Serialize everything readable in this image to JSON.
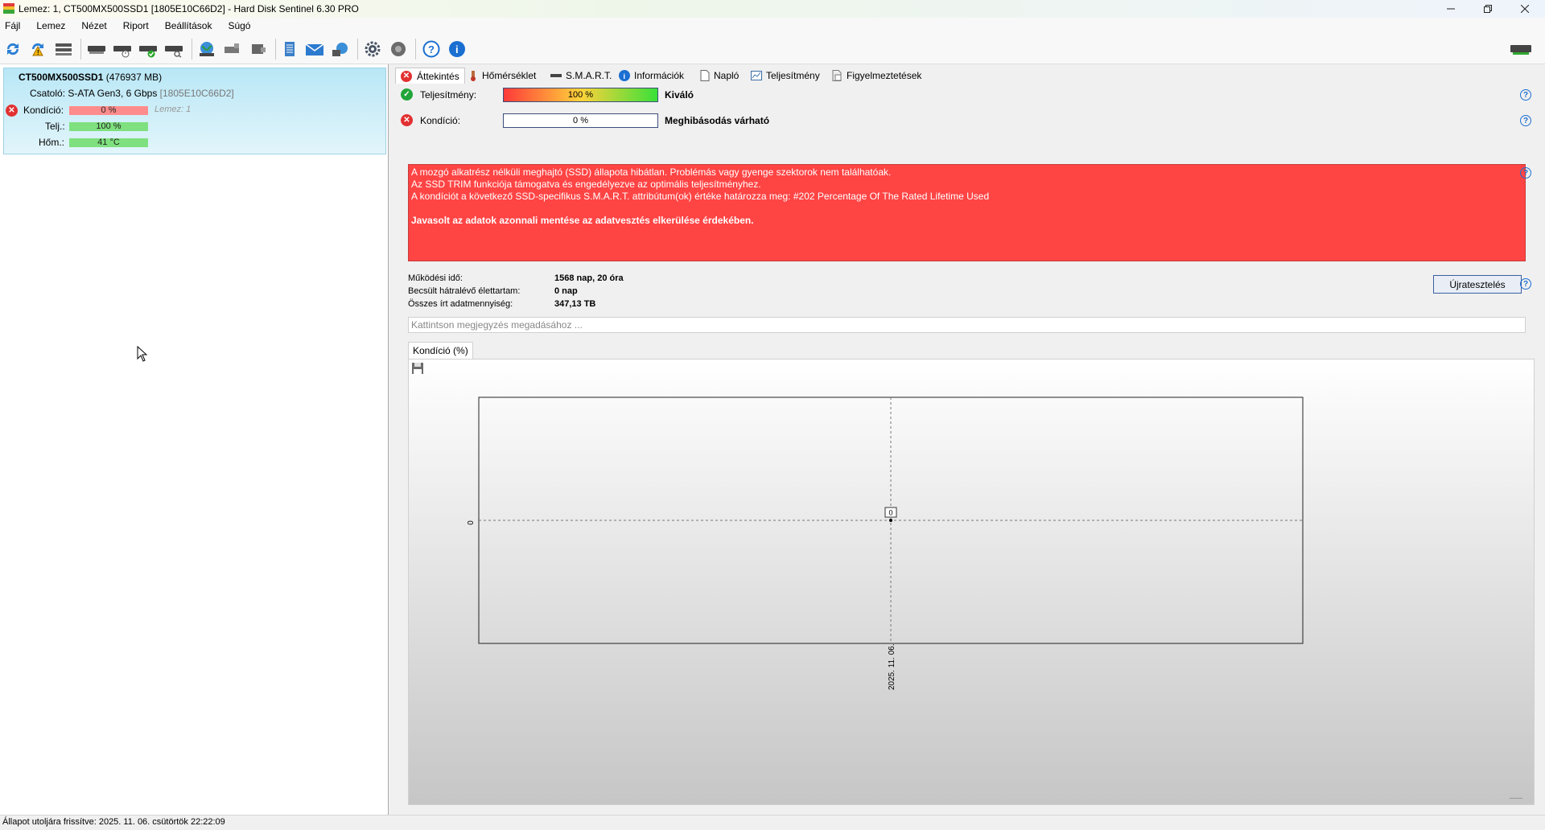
{
  "window": {
    "title": "Lemez: 1, CT500MX500SSD1 [1805E10C66D2]  -  Hard Disk Sentinel 6.30 PRO",
    "minimize_icon": "minimize-icon",
    "maximize_icon": "restore-icon",
    "close_icon": "close-icon"
  },
  "menu": [
    "Fájl",
    "Lemez",
    "Nézet",
    "Riport",
    "Beállítások",
    "Súgó"
  ],
  "toolbar_icons": [
    "refresh-icon",
    "refresh-warning-icon",
    "disk-list-icon",
    "disk-icon",
    "disk-clock-icon",
    "disk-check-icon",
    "disk-search-icon",
    "globe-icon",
    "tools-icon",
    "usb-icon",
    "notes-icon",
    "email-icon",
    "network-icon",
    "settings-icon",
    "sound-icon",
    "help-icon",
    "info-icon"
  ],
  "disk": {
    "name": "CT500MX500SSD1",
    "size": "(476937 MB)",
    "interface_label": "Csatoló:",
    "interface": "S-ATA Gen3, 6 Gbps",
    "serial": "[1805E10C66D2]",
    "health_label": "Kondíció:",
    "health_value": "0 %",
    "health_fraction": 0.0,
    "disk_index": "Lemez: 1",
    "perf_label": "Telj.:",
    "perf_value": "100 %",
    "perf_fraction": 1.0,
    "temp_label": "Hőm.:",
    "temp_value": "41 °C"
  },
  "tabs": [
    "Áttekintés",
    "Hőmérséklet",
    "S.M.A.R.T.",
    "Információk",
    "Napló",
    "Teljesítmény",
    "Figyelmeztetések"
  ],
  "overview": {
    "performance_label": "Teljesítmény:",
    "performance_value": "100 %",
    "performance_fraction": 1.0,
    "performance_text": "Kiváló",
    "health_label": "Kondíció:",
    "health_value": "0 %",
    "health_fraction": 0.0,
    "health_text": "Meghibásodás várható",
    "alert_lines": [
      "A mozgó alkatrész nélküli meghajtó (SSD) állapota hibátlan. Problémás vagy gyenge szektorok nem találhatóak.",
      "Az SSD TRIM funkciója támogatva és engedélyezve az optimális teljesítményhez.",
      "A kondíciót a következő SSD-specifikus S.M.A.R.T. attribútum(ok) értéke határozza meg:  #202 Percentage Of The Rated Lifetime Used"
    ],
    "alert_bold": "Javasolt az adatok azonnali mentése az adatvesztés elkerülése érdekében.",
    "uptime_label": "Működési idő:",
    "uptime_value": "1568 nap, 20 óra",
    "lifetime_label": "Becsült hátralévő élettartam:",
    "lifetime_value": "0 nap",
    "written_label": "Összes írt adatmennyiség:",
    "written_value": "347,13 TB",
    "retest_button": "Újratesztelés",
    "note_placeholder": "Kattintson megjegyzés megadásához ...",
    "graph_tab": "Kondíció  (%)"
  },
  "chart_data": {
    "type": "line",
    "x": [
      "2025. 11. 06."
    ],
    "series": [
      {
        "values": [
          0
        ]
      }
    ],
    "ytick_labels": [
      "0"
    ],
    "data_labels": [
      "0"
    ],
    "grid": true
  },
  "statusbar": {
    "text": "Állapot utoljára frissítve: 2025. 11. 06. csütörtök 22:22:09"
  },
  "colors": {
    "alert_bg": "#ff4444",
    "card_bg": "#c5ecf8",
    "health_bar": "#ff8c8c",
    "ok_bar": "#7ee07e",
    "accent_blue": "#1b6fd1"
  }
}
